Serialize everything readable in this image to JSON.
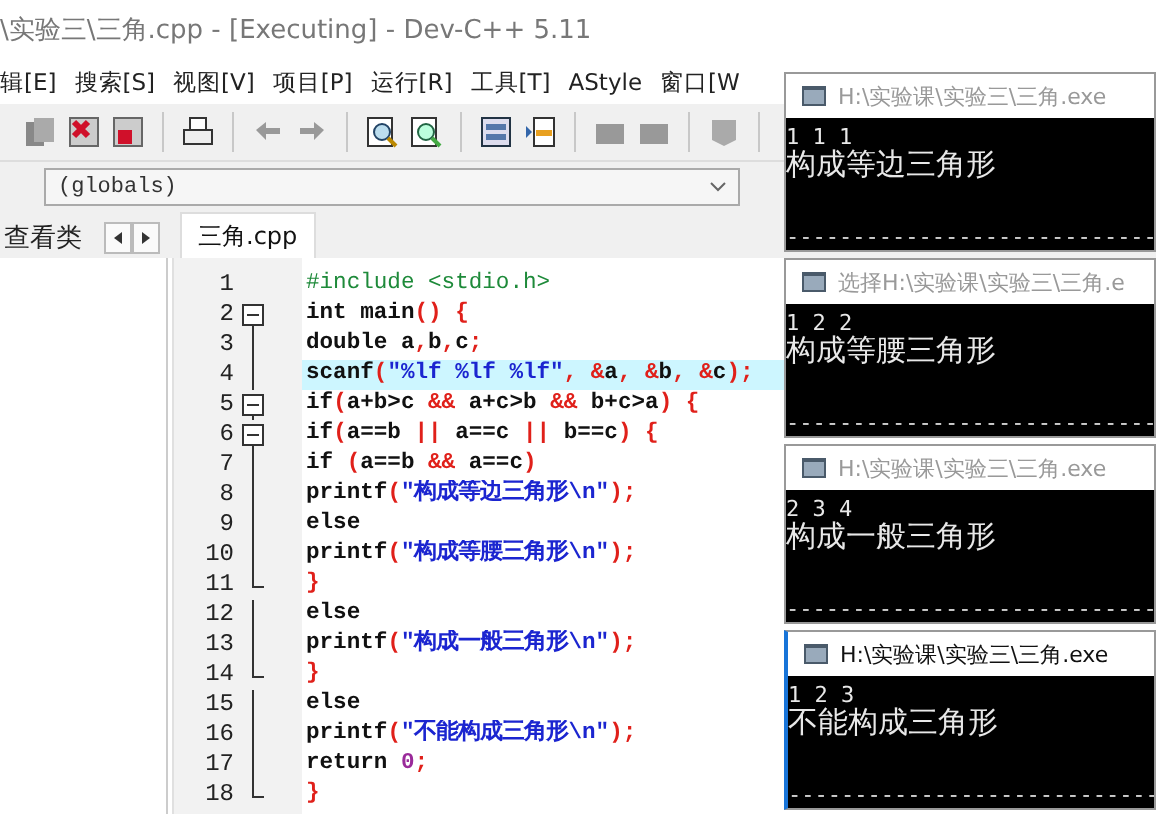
{
  "window": {
    "title": "\\实验三\\三角.cpp - [Executing] - Dev-C++ 5.11"
  },
  "menu": [
    "辑[E]",
    "搜索[S]",
    "视图[V]",
    "项目[P]",
    "运行[R]",
    "工具[T]",
    "AStyle",
    "窗口[W"
  ],
  "scope_combo": {
    "value": "(globals)"
  },
  "side_tabs": [
    {
      "label": "查看类",
      "selected": false
    }
  ],
  "editor_tabs": [
    {
      "label": "三角.cpp",
      "selected": true
    }
  ],
  "code": [
    {
      "number": "1",
      "kind": "plain",
      "selected": false,
      "tokens": [
        {
          "kind": "directive",
          "text": "#include <stdio.h>"
        }
      ]
    },
    {
      "number": "2",
      "kind": "fold_start",
      "selected": false,
      "tokens": [
        {
          "kind": "word",
          "text": "int main"
        },
        {
          "kind": "symbol",
          "text": "() {"
        }
      ]
    },
    {
      "number": "3",
      "kind": "fold_body",
      "selected": false,
      "tokens": [
        {
          "kind": "word",
          "text": "double a"
        },
        {
          "kind": "symbol",
          "text": ","
        },
        {
          "kind": "word",
          "text": "b"
        },
        {
          "kind": "symbol",
          "text": ","
        },
        {
          "kind": "word",
          "text": "c"
        },
        {
          "kind": "symbol",
          "text": ";"
        }
      ]
    },
    {
      "number": "4",
      "kind": "fold_body",
      "selected": true,
      "tokens": [
        {
          "kind": "word",
          "text": "scanf"
        },
        {
          "kind": "symbol",
          "text": "("
        },
        {
          "kind": "string",
          "text": "\"%lf %lf %lf\""
        },
        {
          "kind": "symbol",
          "text": ", &"
        },
        {
          "kind": "word",
          "text": "a"
        },
        {
          "kind": "symbol",
          "text": ", &"
        },
        {
          "kind": "word",
          "text": "b"
        },
        {
          "kind": "symbol",
          "text": ", &"
        },
        {
          "kind": "word",
          "text": "c"
        },
        {
          "kind": "symbol",
          "text": ");"
        }
      ]
    },
    {
      "number": "5",
      "kind": "fold_start",
      "selected": false,
      "tokens": [
        {
          "kind": "word",
          "text": "if"
        },
        {
          "kind": "symbol",
          "text": "("
        },
        {
          "kind": "word",
          "text": "a+b>c "
        },
        {
          "kind": "symbol",
          "text": "&&"
        },
        {
          "kind": "word",
          "text": " a+c>b "
        },
        {
          "kind": "symbol",
          "text": "&&"
        },
        {
          "kind": "word",
          "text": " b+c>a"
        },
        {
          "kind": "symbol",
          "text": ") {"
        }
      ]
    },
    {
      "number": "6",
      "kind": "fold_start",
      "selected": false,
      "tokens": [
        {
          "kind": "word",
          "text": "if"
        },
        {
          "kind": "symbol",
          "text": "("
        },
        {
          "kind": "word",
          "text": "a==b "
        },
        {
          "kind": "symbol",
          "text": "||"
        },
        {
          "kind": "word",
          "text": " a==c "
        },
        {
          "kind": "symbol",
          "text": "||"
        },
        {
          "kind": "word",
          "text": " b==c"
        },
        {
          "kind": "symbol",
          "text": ") {"
        }
      ]
    },
    {
      "number": "7",
      "kind": "fold_body",
      "selected": false,
      "tokens": [
        {
          "kind": "word",
          "text": "if "
        },
        {
          "kind": "symbol",
          "text": "("
        },
        {
          "kind": "word",
          "text": "a==b "
        },
        {
          "kind": "symbol",
          "text": "&&"
        },
        {
          "kind": "word",
          "text": " a==c"
        },
        {
          "kind": "symbol",
          "text": ")"
        }
      ]
    },
    {
      "number": "8",
      "kind": "fold_body",
      "selected": false,
      "tokens": [
        {
          "kind": "word",
          "text": "printf"
        },
        {
          "kind": "symbol",
          "text": "("
        },
        {
          "kind": "string",
          "text": "\"构成等边三角形\\n\""
        },
        {
          "kind": "symbol",
          "text": ");"
        }
      ]
    },
    {
      "number": "9",
      "kind": "fold_body",
      "selected": false,
      "tokens": [
        {
          "kind": "word",
          "text": "else"
        }
      ]
    },
    {
      "number": "10",
      "kind": "fold_body",
      "selected": false,
      "tokens": [
        {
          "kind": "word",
          "text": "printf"
        },
        {
          "kind": "symbol",
          "text": "("
        },
        {
          "kind": "string",
          "text": "\"构成等腰三角形\\n\""
        },
        {
          "kind": "symbol",
          "text": ");"
        }
      ]
    },
    {
      "number": "11",
      "kind": "fold_end",
      "selected": false,
      "tokens": [
        {
          "kind": "symbol",
          "text": "}"
        }
      ]
    },
    {
      "number": "12",
      "kind": "fold_body",
      "selected": false,
      "tokens": [
        {
          "kind": "word",
          "text": "else"
        }
      ]
    },
    {
      "number": "13",
      "kind": "fold_body",
      "selected": false,
      "tokens": [
        {
          "kind": "word",
          "text": "printf"
        },
        {
          "kind": "symbol",
          "text": "("
        },
        {
          "kind": "string",
          "text": "\"构成一般三角形\\n\""
        },
        {
          "kind": "symbol",
          "text": ");"
        }
      ]
    },
    {
      "number": "14",
      "kind": "fold_end",
      "selected": false,
      "tokens": [
        {
          "kind": "symbol",
          "text": "}"
        }
      ]
    },
    {
      "number": "15",
      "kind": "fold_body",
      "selected": false,
      "tokens": [
        {
          "kind": "word",
          "text": "else"
        }
      ]
    },
    {
      "number": "16",
      "kind": "fold_body",
      "selected": false,
      "tokens": [
        {
          "kind": "word",
          "text": "printf"
        },
        {
          "kind": "symbol",
          "text": "("
        },
        {
          "kind": "string",
          "text": "\"不能构成三角形\\n\""
        },
        {
          "kind": "symbol",
          "text": ");"
        }
      ]
    },
    {
      "number": "17",
      "kind": "fold_body",
      "selected": false,
      "tokens": [
        {
          "kind": "word",
          "text": "return "
        },
        {
          "kind": "number",
          "text": "0"
        },
        {
          "kind": "symbol",
          "text": ";"
        }
      ]
    },
    {
      "number": "18",
      "kind": "fold_end",
      "selected": false,
      "tokens": [
        {
          "kind": "symbol",
          "text": "}"
        }
      ]
    }
  ],
  "consoles": [
    {
      "title": "H:\\实验课\\实验三\\三角.exe",
      "active": false,
      "lines": [
        {
          "kind": "input",
          "text": "1 1 1"
        },
        {
          "kind": "output",
          "text": "构成等边三角形"
        }
      ],
      "separator": "----------------------------"
    },
    {
      "title": "选择H:\\实验课\\实验三\\三角.e",
      "active": false,
      "lines": [
        {
          "kind": "input",
          "text": "1 2 2"
        },
        {
          "kind": "output",
          "text": "构成等腰三角形"
        }
      ],
      "separator": "----------------------------"
    },
    {
      "title": "H:\\实验课\\实验三\\三角.exe",
      "active": false,
      "lines": [
        {
          "kind": "input",
          "text": "2 3 4"
        },
        {
          "kind": "output",
          "text": "构成一般三角形"
        }
      ],
      "separator": "----------------------------"
    },
    {
      "title": "H:\\实验课\\实验三\\三角.exe",
      "active": true,
      "lines": [
        {
          "kind": "input",
          "text": "1 2 3"
        },
        {
          "kind": "output",
          "text": "不能构成三角形"
        }
      ],
      "separator": "----------------------------"
    }
  ]
}
